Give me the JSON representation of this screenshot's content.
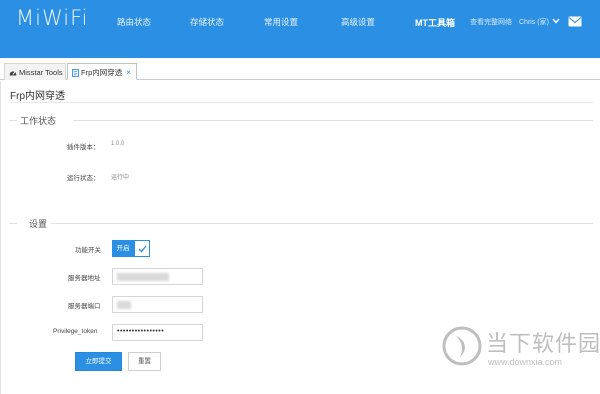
{
  "header": {
    "logo": "MiWiFi",
    "nav": [
      "路由状态",
      "存储状态",
      "常用设置",
      "高级设置",
      "MT工具箱"
    ],
    "active_nav": "MT工具箱",
    "account_link": "查看完整网络",
    "user": "Chris (家)",
    "icons": [
      "chevron-down-icon",
      "mail-icon"
    ],
    "accent_color": "#2b8fe3"
  },
  "tabs": [
    {
      "label": "Misstar Tools",
      "icon": "gauge-icon"
    },
    {
      "label": "Frp内网穿透",
      "icon": "document-icon",
      "close": "×"
    }
  ],
  "page": {
    "title": "Frp内网穿透",
    "status_section": {
      "title": "工作状态",
      "plugin_version_label": "插件版本：",
      "plugin_version_value": "1.0.0",
      "run_status_label": "运行状态：",
      "run_status_value": "运行中"
    },
    "settings_section": {
      "title": "设置",
      "switch_label": "功能开关",
      "switch_value": "开启",
      "server_addr_label": "服务器地址",
      "server_addr_value": "",
      "server_port_label": "服务器端口",
      "server_port_value": "",
      "token_label": "Privilege_token",
      "token_value": "••••••••••••••••"
    },
    "submit_button": "立即提交",
    "reset_button": "重置"
  },
  "watermark": {
    "text": "当下软件园",
    "url": "www.downxia.com"
  }
}
